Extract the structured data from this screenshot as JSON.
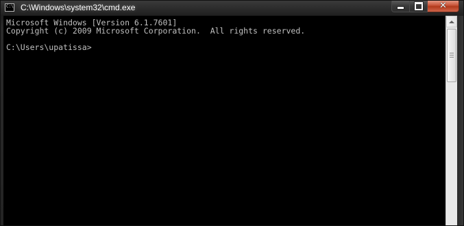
{
  "window": {
    "title": "C:\\Windows\\system32\\cmd.exe",
    "app_icon_glyph": "C:\\"
  },
  "controls": {
    "minimize_icon": "minimize-icon",
    "maximize_icon": "maximize-icon",
    "close_glyph": "✕"
  },
  "console": {
    "lines": [
      "Microsoft Windows [Version 6.1.7601]",
      "Copyright (c) 2009 Microsoft Corporation.  All rights reserved.",
      "",
      "C:\\Users\\upatissa>"
    ],
    "background": "#000000",
    "text_color": "#c0c0c0"
  },
  "scrollbar": {
    "position_fraction": 0.0
  }
}
